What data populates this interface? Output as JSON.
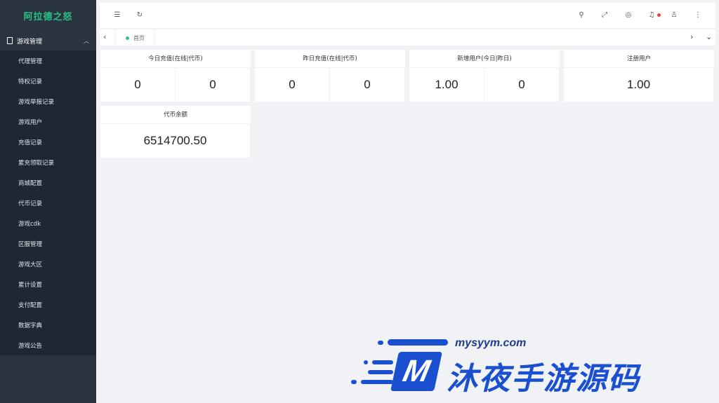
{
  "sidebar": {
    "logo": "阿拉德之怒",
    "group_label": "游戏管理",
    "items": [
      "代理管理",
      "特权记录",
      "游戏举报记录",
      "游戏用户",
      "充值记录",
      "累充领取记录",
      "商城配置",
      "代币记录",
      "游戏cdk",
      "区服管理",
      "游戏大区",
      "累计设置",
      "支付配置",
      "数据字典",
      "游戏公告"
    ]
  },
  "header": {
    "icons": [
      "menu-fold-icon",
      "refresh-icon",
      "search-icon",
      "fullscreen-icon",
      "language-icon",
      "bell-icon",
      "user-icon",
      "more-icon"
    ]
  },
  "tabs": {
    "home_label": "首页"
  },
  "cards": [
    {
      "title": "今日充值(在线|代币)",
      "values": [
        "0",
        "0"
      ]
    },
    {
      "title": "昨日充值(在线|代币)",
      "values": [
        "0",
        "0"
      ]
    },
    {
      "title": "新增用户(今日|昨日)",
      "values": [
        "1.00",
        "0"
      ]
    },
    {
      "title": "注册用户",
      "values": [
        "1.00"
      ]
    },
    {
      "title": "代币余额",
      "values": [
        "6514700.50"
      ]
    }
  ],
  "watermark": {
    "url": "mysyym.com",
    "logo_letter": "M",
    "text": "沐夜手游源码"
  },
  "colors": {
    "sidebar_bg": "#2a3441",
    "submenu_bg": "#1f2732",
    "logo_green": "#27c083",
    "notify_red": "#e8483a",
    "watermark_blue": "#1a4fd0"
  }
}
